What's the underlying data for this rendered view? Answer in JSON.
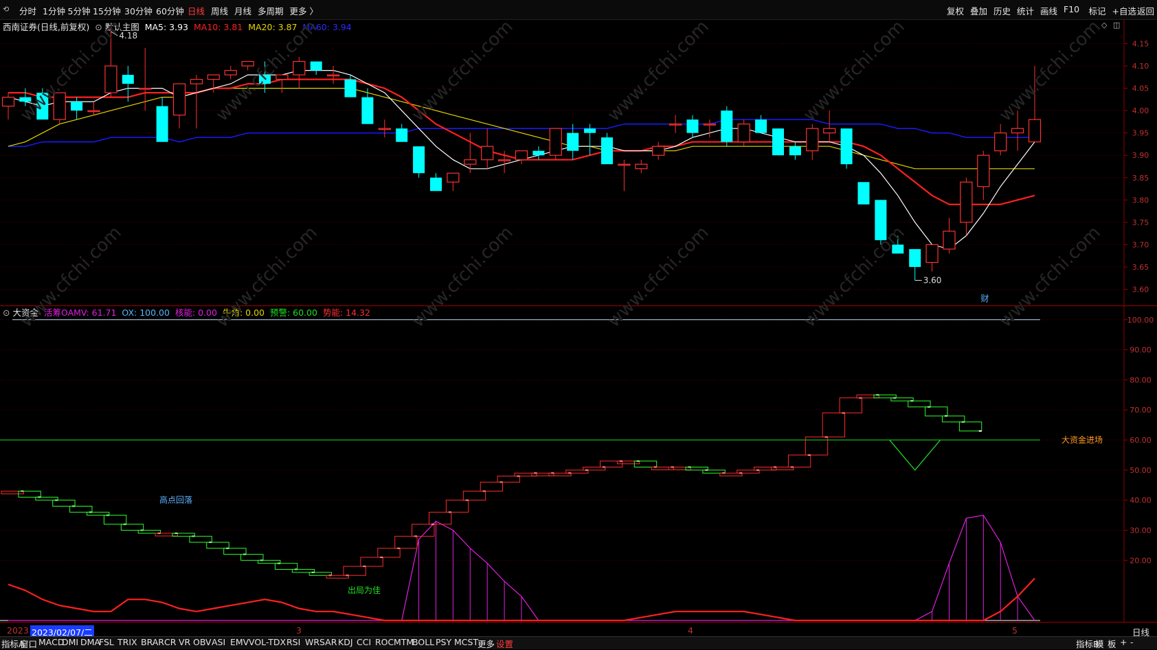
{
  "toolbar": {
    "periods": [
      "分时",
      "1分钟",
      "5分钟",
      "15分钟",
      "30分钟",
      "60分钟",
      "日线",
      "周线",
      "月线",
      "多周期",
      "更多 〉"
    ],
    "active_period": "日线",
    "right_items": [
      "复权",
      "叠加",
      "历史",
      "统计",
      "画线",
      "F10",
      "标记",
      "+自选",
      "返回"
    ]
  },
  "main_chart": {
    "title": "西南证券(日线,前复权)",
    "template": "默认主图",
    "ma5": "MA5: 3.93",
    "ma10": "MA10: 3.81",
    "ma20": "MA20: 3.87",
    "ma60": "MA60: 3.94",
    "high_label": "4.18",
    "low_label": "3.60",
    "event_marker": "财"
  },
  "indicator": {
    "name": "大资金",
    "oamv": "活筹OAMV: 61.71",
    "ox": "OX: 100.00",
    "hn": "核能: 0.00",
    "nj": "牛角: 0.00",
    "yj": "预警: 60.00",
    "sn": "势能: 14.32",
    "annotations": [
      "高点回落",
      "出局为佳",
      "大资金进场"
    ]
  },
  "date_axis": {
    "year": "2023",
    "cursor_date": "2023/02/07/二",
    "months": [
      "3",
      "4",
      "5"
    ],
    "period": "日线"
  },
  "bottom_tabs": {
    "items": [
      "指标A",
      "窗口",
      "MACD",
      "DMI",
      "DMA",
      "FSL",
      "TRIX",
      "BRAR",
      "CR",
      "VR",
      "OBV",
      "ASI",
      "EMV",
      "VOL-TDX",
      "RSI",
      "WR",
      "SAR",
      "KDJ",
      "CCI",
      "ROC",
      "MTM",
      "BOLL",
      "PSY",
      "MCST",
      "更多",
      "设置"
    ],
    "right": [
      "指标B",
      "模",
      "板",
      "+",
      "-"
    ]
  },
  "colors": {
    "up": "#ff3232",
    "down": "#00ffff",
    "ma5": "#ffffff",
    "ma10": "#ff2020",
    "ma20": "#e6d600",
    "ma60": "#1a1aff",
    "grid": "#5a0000",
    "purple": "#e020e0",
    "green": "#20e020"
  },
  "chart_data": [
    {
      "type": "candlestick",
      "ylim": [
        3.57,
        4.18
      ],
      "yticks": [
        3.6,
        3.65,
        3.7,
        3.75,
        3.8,
        3.85,
        3.9,
        3.95,
        4.0,
        4.05,
        4.1,
        4.15
      ],
      "candles_ohlc": [
        [
          4.01,
          4.04,
          3.98,
          4.03
        ],
        [
          4.03,
          4.05,
          4.01,
          4.02
        ],
        [
          4.04,
          4.05,
          3.98,
          3.98
        ],
        [
          3.98,
          4.04,
          3.97,
          4.04
        ],
        [
          4.02,
          4.03,
          3.98,
          4.0
        ],
        [
          4.0,
          4.02,
          3.99,
          4.0
        ],
        [
          4.04,
          4.18,
          4.03,
          4.1
        ],
        [
          4.08,
          4.1,
          4.02,
          4.06
        ],
        [
          4.05,
          4.14,
          4.0,
          4.05
        ],
        [
          4.01,
          4.03,
          3.93,
          3.93
        ],
        [
          3.99,
          4.06,
          3.96,
          4.06
        ],
        [
          4.06,
          4.08,
          3.96,
          4.07
        ],
        [
          4.07,
          4.08,
          4.04,
          4.08
        ],
        [
          4.08,
          4.1,
          4.07,
          4.09
        ],
        [
          4.1,
          4.11,
          4.09,
          4.11
        ],
        [
          4.08,
          4.11,
          4.04,
          4.06
        ],
        [
          4.07,
          4.08,
          4.04,
          4.08
        ],
        [
          4.08,
          4.12,
          4.05,
          4.11
        ],
        [
          4.11,
          4.11,
          4.08,
          4.09
        ],
        [
          4.08,
          4.1,
          4.06,
          4.08
        ],
        [
          4.07,
          4.08,
          4.03,
          4.03
        ],
        [
          4.03,
          4.05,
          3.97,
          3.97
        ],
        [
          3.96,
          3.98,
          3.94,
          3.96
        ],
        [
          3.96,
          3.97,
          3.93,
          3.93
        ],
        [
          3.92,
          3.92,
          3.85,
          3.86
        ],
        [
          3.85,
          3.86,
          3.83,
          3.82
        ],
        [
          3.84,
          3.86,
          3.82,
          3.86
        ],
        [
          3.88,
          3.95,
          3.86,
          3.89
        ],
        [
          3.89,
          3.96,
          3.87,
          3.92
        ],
        [
          3.89,
          3.91,
          3.86,
          3.89
        ],
        [
          3.89,
          3.91,
          3.88,
          3.91
        ],
        [
          3.91,
          3.92,
          3.89,
          3.9
        ],
        [
          3.9,
          3.96,
          3.89,
          3.96
        ],
        [
          3.95,
          3.97,
          3.89,
          3.91
        ],
        [
          3.96,
          3.97,
          3.9,
          3.95
        ],
        [
          3.94,
          3.95,
          3.92,
          3.88
        ],
        [
          3.88,
          3.89,
          3.82,
          3.88
        ],
        [
          3.87,
          3.89,
          3.86,
          3.88
        ],
        [
          3.9,
          3.93,
          3.89,
          3.92
        ],
        [
          3.97,
          3.99,
          3.95,
          3.97
        ],
        [
          3.98,
          3.99,
          3.94,
          3.95
        ],
        [
          3.97,
          3.98,
          3.94,
          3.97
        ],
        [
          4.0,
          4.01,
          3.92,
          3.93
        ],
        [
          3.93,
          3.98,
          3.92,
          3.97
        ],
        [
          3.98,
          3.99,
          3.95,
          3.95
        ],
        [
          3.96,
          3.96,
          3.9,
          3.9
        ],
        [
          3.92,
          3.93,
          3.89,
          3.9
        ],
        [
          3.91,
          3.97,
          3.89,
          3.96
        ],
        [
          3.95,
          4.0,
          3.93,
          3.96
        ],
        [
          3.96,
          3.96,
          3.87,
          3.88
        ],
        [
          3.84,
          3.84,
          3.8,
          3.79
        ],
        [
          3.8,
          3.8,
          3.7,
          3.71
        ],
        [
          3.7,
          3.72,
          3.68,
          3.68
        ],
        [
          3.69,
          3.69,
          3.62,
          3.65
        ],
        [
          3.66,
          3.7,
          3.64,
          3.7
        ],
        [
          3.69,
          3.76,
          3.68,
          3.73
        ],
        [
          3.75,
          3.85,
          3.72,
          3.84
        ],
        [
          3.83,
          3.91,
          3.8,
          3.9
        ],
        [
          3.91,
          3.97,
          3.9,
          3.95
        ],
        [
          3.95,
          4.0,
          3.91,
          3.96
        ],
        [
          3.93,
          4.1,
          3.93,
          3.98
        ]
      ],
      "ma5": [
        4.03,
        4.02,
        4.01,
        4.02,
        4.02,
        4.02,
        4.04,
        4.05,
        4.05,
        4.05,
        4.03,
        4.04,
        4.05,
        4.06,
        4.08,
        4.08,
        4.08,
        4.09,
        4.09,
        4.09,
        4.08,
        4.06,
        4.04,
        4.0,
        3.96,
        3.92,
        3.89,
        3.87,
        3.87,
        3.88,
        3.89,
        3.9,
        3.91,
        3.92,
        3.92,
        3.92,
        3.91,
        3.91,
        3.91,
        3.92,
        3.94,
        3.95,
        3.96,
        3.96,
        3.95,
        3.94,
        3.93,
        3.93,
        3.93,
        3.92,
        3.9,
        3.86,
        3.81,
        3.75,
        3.7,
        3.69,
        3.72,
        3.77,
        3.83,
        3.88,
        3.93
      ],
      "ma10": [
        4.04,
        4.04,
        4.03,
        4.03,
        4.03,
        4.03,
        4.03,
        4.03,
        4.04,
        4.04,
        4.04,
        4.04,
        4.05,
        4.05,
        4.06,
        4.06,
        4.07,
        4.07,
        4.07,
        4.07,
        4.07,
        4.06,
        4.05,
        4.03,
        4.0,
        3.97,
        3.95,
        3.93,
        3.91,
        3.9,
        3.89,
        3.89,
        3.89,
        3.89,
        3.9,
        3.91,
        3.91,
        3.91,
        3.92,
        3.92,
        3.93,
        3.93,
        3.93,
        3.93,
        3.93,
        3.93,
        3.93,
        3.93,
        3.93,
        3.93,
        3.92,
        3.9,
        3.87,
        3.84,
        3.81,
        3.79,
        3.79,
        3.79,
        3.79,
        3.8,
        3.81
      ],
      "ma20": [
        3.92,
        3.93,
        3.95,
        3.97,
        3.98,
        3.99,
        4.0,
        4.01,
        4.02,
        4.03,
        4.03,
        4.04,
        4.05,
        4.05,
        4.05,
        4.05,
        4.05,
        4.05,
        4.05,
        4.05,
        4.05,
        4.04,
        4.03,
        4.02,
        4.01,
        4.0,
        3.99,
        3.98,
        3.97,
        3.96,
        3.95,
        3.94,
        3.93,
        3.92,
        3.92,
        3.91,
        3.91,
        3.91,
        3.91,
        3.91,
        3.92,
        3.92,
        3.92,
        3.92,
        3.92,
        3.92,
        3.92,
        3.92,
        3.92,
        3.91,
        3.9,
        3.89,
        3.88,
        3.87,
        3.87,
        3.87,
        3.87,
        3.87,
        3.87,
        3.87,
        3.87
      ],
      "ma60": [
        3.92,
        3.92,
        3.93,
        3.93,
        3.93,
        3.93,
        3.94,
        3.94,
        3.94,
        3.94,
        3.93,
        3.94,
        3.94,
        3.94,
        3.95,
        3.95,
        3.95,
        3.95,
        3.95,
        3.95,
        3.95,
        3.95,
        3.95,
        3.95,
        3.96,
        3.96,
        3.96,
        3.96,
        3.96,
        3.96,
        3.96,
        3.96,
        3.96,
        3.96,
        3.96,
        3.96,
        3.97,
        3.97,
        3.97,
        3.97,
        3.97,
        3.97,
        3.98,
        3.98,
        3.98,
        3.98,
        3.98,
        3.98,
        3.97,
        3.97,
        3.97,
        3.97,
        3.96,
        3.96,
        3.95,
        3.95,
        3.94,
        3.94,
        3.94,
        3.94,
        3.94
      ]
    },
    {
      "type": "line",
      "ylim": [
        0,
        102
      ],
      "yticks": [
        20,
        30,
        40,
        50,
        60,
        70,
        80,
        90,
        100
      ],
      "ref_lines": [
        100,
        60
      ],
      "oamv_boxes": [
        43,
        41,
        40,
        38,
        36,
        35,
        32,
        30,
        29,
        29,
        28,
        26,
        24,
        22,
        20,
        19,
        17,
        16,
        15,
        15,
        18,
        21,
        24,
        28,
        32,
        36,
        40,
        43,
        46,
        48,
        49,
        49,
        49,
        50,
        51,
        53,
        53,
        51,
        51,
        51,
        50,
        49,
        49,
        50,
        51,
        51,
        55,
        61,
        69,
        74,
        75,
        74,
        73,
        71,
        68,
        66,
        63
      ],
      "red_line": [
        12,
        10,
        7,
        5,
        4,
        3,
        3,
        7,
        7,
        6,
        4,
        3,
        4,
        5,
        6,
        7,
        6,
        4,
        3,
        3,
        2,
        1,
        0,
        0,
        0,
        0,
        0,
        0,
        0,
        0,
        0,
        0,
        0,
        0,
        0,
        0,
        0,
        1,
        2,
        3,
        3,
        3,
        3,
        3,
        2,
        1,
        0,
        0,
        0,
        0,
        0,
        0,
        0,
        0,
        0,
        0,
        0,
        0,
        3,
        8,
        14
      ],
      "purple_hist": [
        0,
        0,
        0,
        0,
        0,
        0,
        0,
        0,
        0,
        0,
        0,
        0,
        0,
        0,
        0,
        0,
        0,
        0,
        0,
        0,
        0,
        0,
        0,
        0,
        27,
        33,
        30,
        24,
        19,
        13,
        8,
        0,
        0,
        0,
        0,
        0,
        0,
        0,
        0,
        0,
        0,
        0,
        0,
        0,
        0,
        0,
        0,
        0,
        0,
        0,
        0,
        0,
        0,
        0,
        3,
        19,
        34,
        35,
        26,
        8,
        0
      ]
    }
  ]
}
